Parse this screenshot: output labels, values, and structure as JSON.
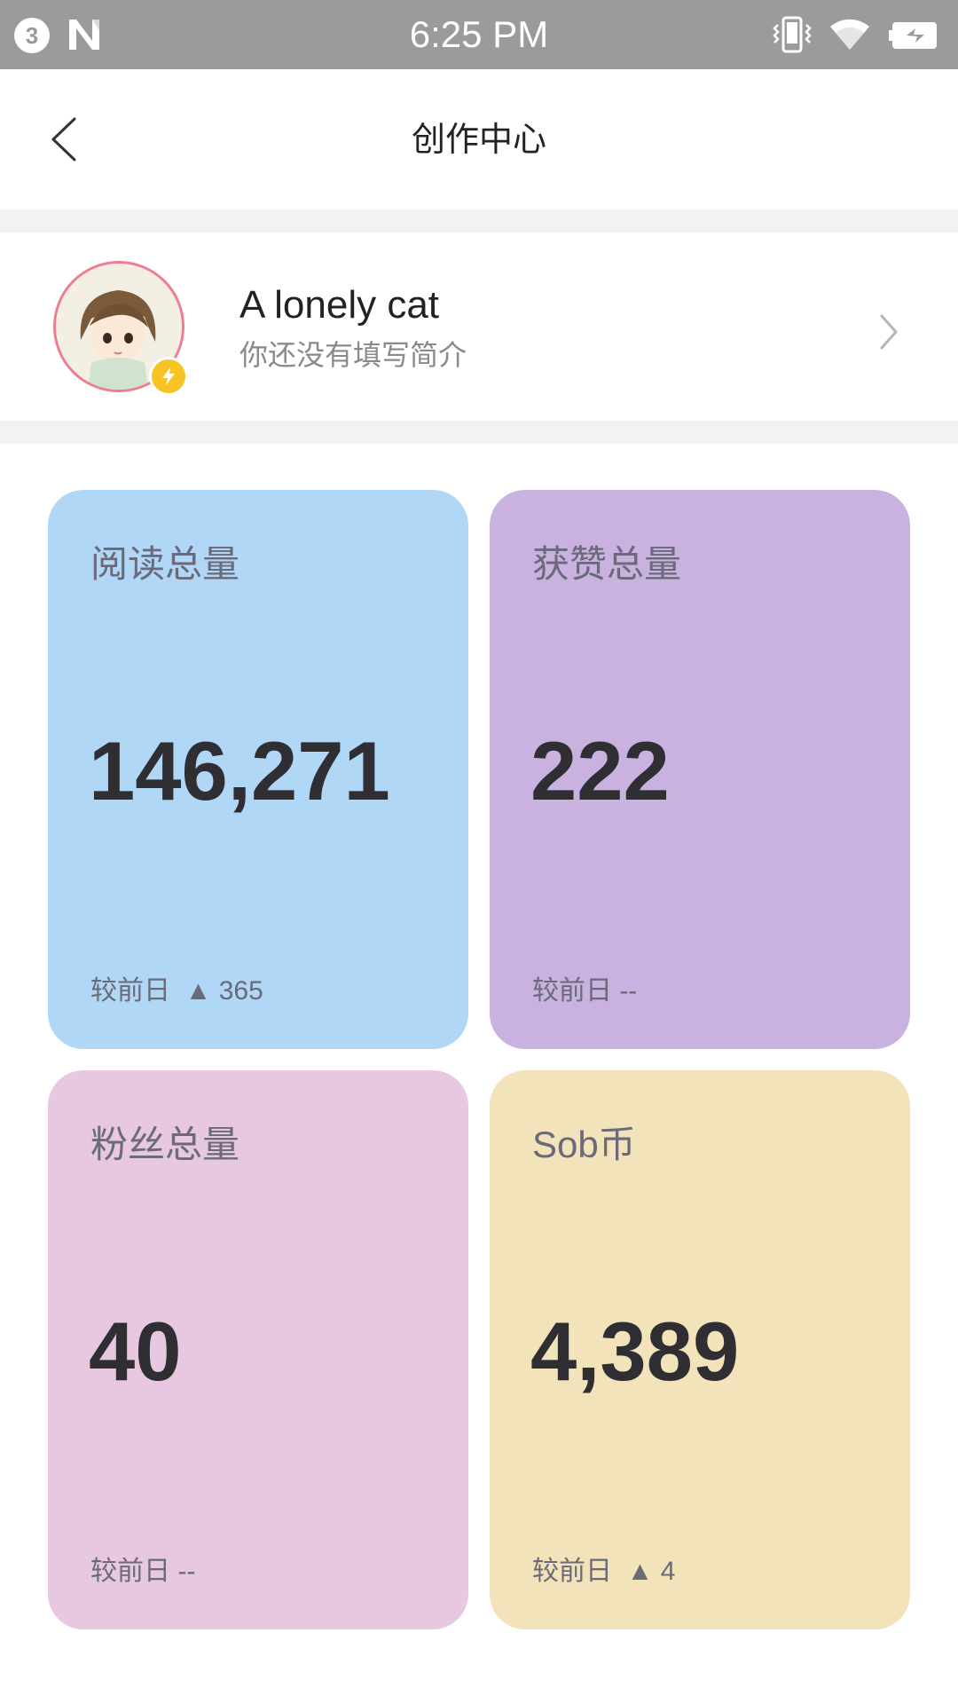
{
  "status_bar": {
    "notification_count": "3",
    "time": "6:25 PM",
    "background": "#9b9b9b",
    "icons": [
      "notification-count-icon",
      "n-icon",
      "vibrate-icon",
      "wifi-icon",
      "battery-charging-icon"
    ]
  },
  "header": {
    "title": "创作中心",
    "back_icon": "chevron-left-icon"
  },
  "profile": {
    "name": "A lonely cat",
    "bio": "你还没有填写简介",
    "avatar_border_color": "#ef7b95",
    "badge_color": "#f7c325",
    "badge_icon": "lightning-icon",
    "chevron_icon": "chevron-right-icon"
  },
  "stats": [
    {
      "title": "阅读总量",
      "value": "146,271",
      "delta": "较前日  ▲ 365",
      "color": "#b0d7f6"
    },
    {
      "title": "获赞总量",
      "value": "222",
      "delta": "较前日 --",
      "color": "#c9b2e0"
    },
    {
      "title": "粉丝总量",
      "value": "40",
      "delta": "较前日 --",
      "color": "#e8c8e0"
    },
    {
      "title": "Sob币",
      "value": "4,389",
      "delta": "较前日  ▲ 4",
      "color": "#f3e3ba"
    }
  ]
}
